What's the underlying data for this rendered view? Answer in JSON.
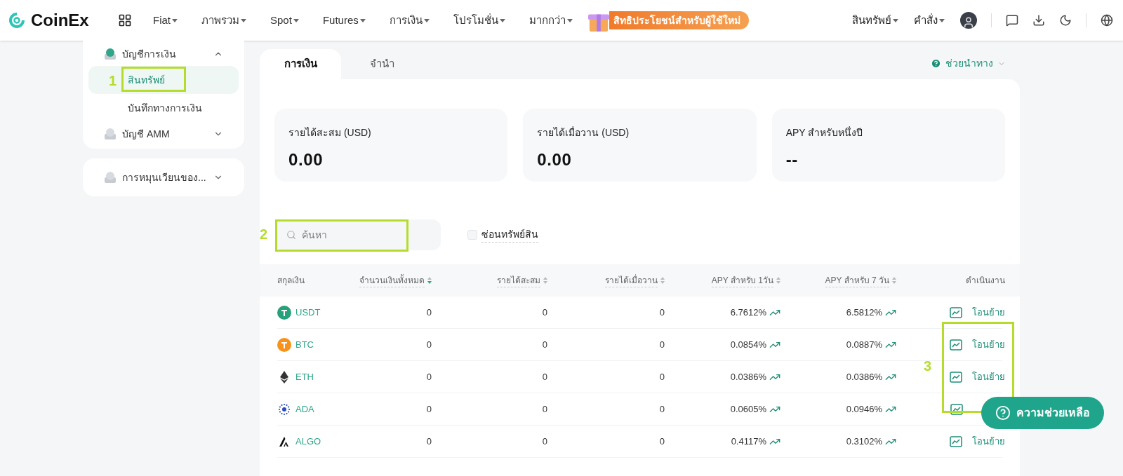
{
  "header": {
    "logo": "CoinEx",
    "nav": [
      "Fiat",
      "ภาพรวม",
      "Spot",
      "Futures",
      "การเงิน",
      "โปรโมชั่น",
      "มากกว่า"
    ],
    "promo": "สิทธิประโยชน์สำหรับผู้ใช้ใหม่",
    "right_menus": [
      "สินทรัพย์",
      "คำสั่ง"
    ]
  },
  "sidebar": {
    "groups": [
      {
        "label": "บัญชีการเงิน",
        "expanded": true,
        "children": [
          {
            "label": "สินทรัพย์",
            "selected": true
          },
          {
            "label": "บันทึกทางการเงิน",
            "selected": false
          }
        ]
      },
      {
        "label": "บัญชี AMM",
        "expanded": false
      },
      {
        "label": "การหมุนเวียนของ...",
        "expanded": false
      }
    ]
  },
  "tabs": [
    {
      "label": "การเงิน",
      "selected": true
    },
    {
      "label": "จำนำ",
      "selected": false
    }
  ],
  "guide": "ช่วยนำทาง",
  "stats": [
    {
      "label": "รายได้สะสม (USD)",
      "value": "0.00"
    },
    {
      "label": "รายได้เมื่อวาน (USD)",
      "value": "0.00"
    },
    {
      "label": "APY สำหรับหนึ่งปี",
      "value": "--"
    }
  ],
  "search": {
    "placeholder": "ค้นหา"
  },
  "hide_assets": {
    "label": "ซ่อนทรัพย์สิน",
    "checked": false
  },
  "table": {
    "columns": [
      "สกุลเงิน",
      "จำนวนเงินทั้งหมด",
      "รายได้สะสม",
      "รายได้เมื่อวาน",
      "APY สำหรับ 1วัน",
      "APY สำหรับ 7 วัน",
      "ดำเนินงาน"
    ],
    "rows": [
      {
        "coin": "USDT",
        "total": "0",
        "accumulated": "0",
        "yesterday": "0",
        "apy_1d": "6.7612%",
        "apy_7d": "6.5812%",
        "action": "โอนย้าย"
      },
      {
        "coin": "BTC",
        "total": "0",
        "accumulated": "0",
        "yesterday": "0",
        "apy_1d": "0.0854%",
        "apy_7d": "0.0887%",
        "action": "โอนย้าย"
      },
      {
        "coin": "ETH",
        "total": "0",
        "accumulated": "0",
        "yesterday": "0",
        "apy_1d": "0.0386%",
        "apy_7d": "0.0386%",
        "action": "โอนย้าย"
      },
      {
        "coin": "ADA",
        "total": "0",
        "accumulated": "0",
        "yesterday": "0",
        "apy_1d": "0.0605%",
        "apy_7d": "0.0946%"
      },
      {
        "coin": "ALGO",
        "total": "0",
        "accumulated": "0",
        "yesterday": "0",
        "apy_1d": "0.4117%",
        "apy_7d": "0.3102%",
        "action": "โอนย้าย"
      }
    ]
  },
  "callouts": [
    "1",
    "2",
    "3"
  ],
  "help_button": "ความช่วยเหลือ"
}
